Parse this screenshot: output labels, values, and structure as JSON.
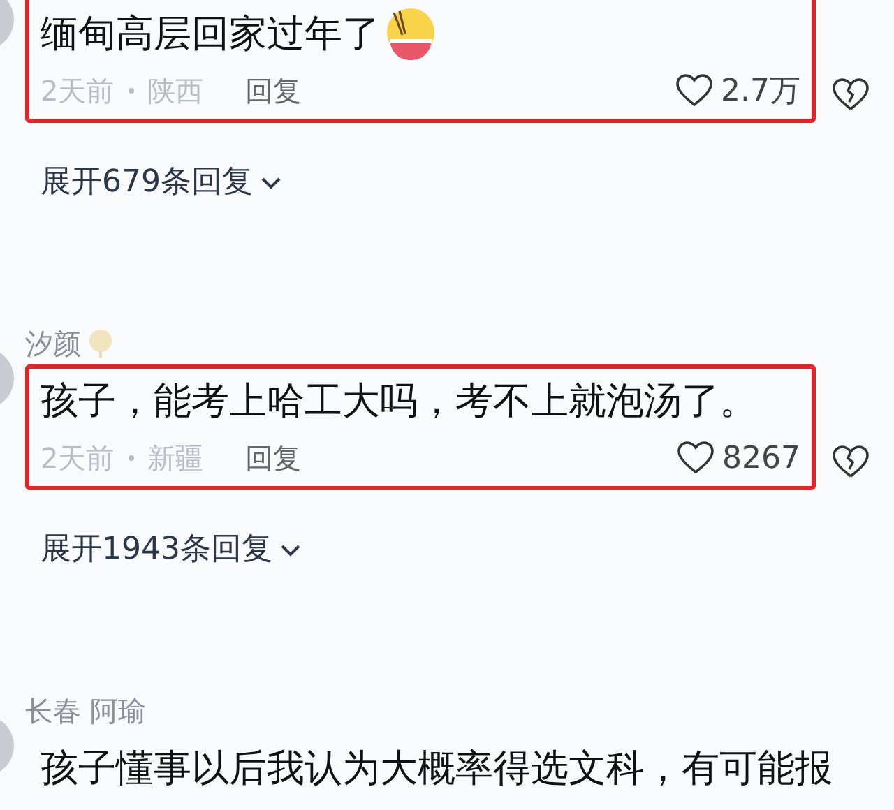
{
  "comments": [
    {
      "text": "缅甸高层回家过年了",
      "trailing_emoji": true,
      "highlighted": true,
      "meta": {
        "time": "2天前",
        "location": "陕西",
        "reply": "回复"
      },
      "likes": "2.7万",
      "expand": "展开679条回复"
    },
    {
      "username": "汐颜",
      "name_badge": true,
      "text": "孩子，能考上哈工大吗，考不上就泡汤了。",
      "trailing_emoji": false,
      "highlighted": true,
      "meta": {
        "time": "2天前",
        "location": "新疆",
        "reply": "回复"
      },
      "likes": "8267",
      "expand": "展开1943条回复"
    },
    {
      "username": "长春 阿瑜",
      "name_badge": false,
      "text": "孩子懂事以后我认为大概率得选文科，有可能报",
      "trailing_emoji": false,
      "highlighted": false
    }
  ]
}
